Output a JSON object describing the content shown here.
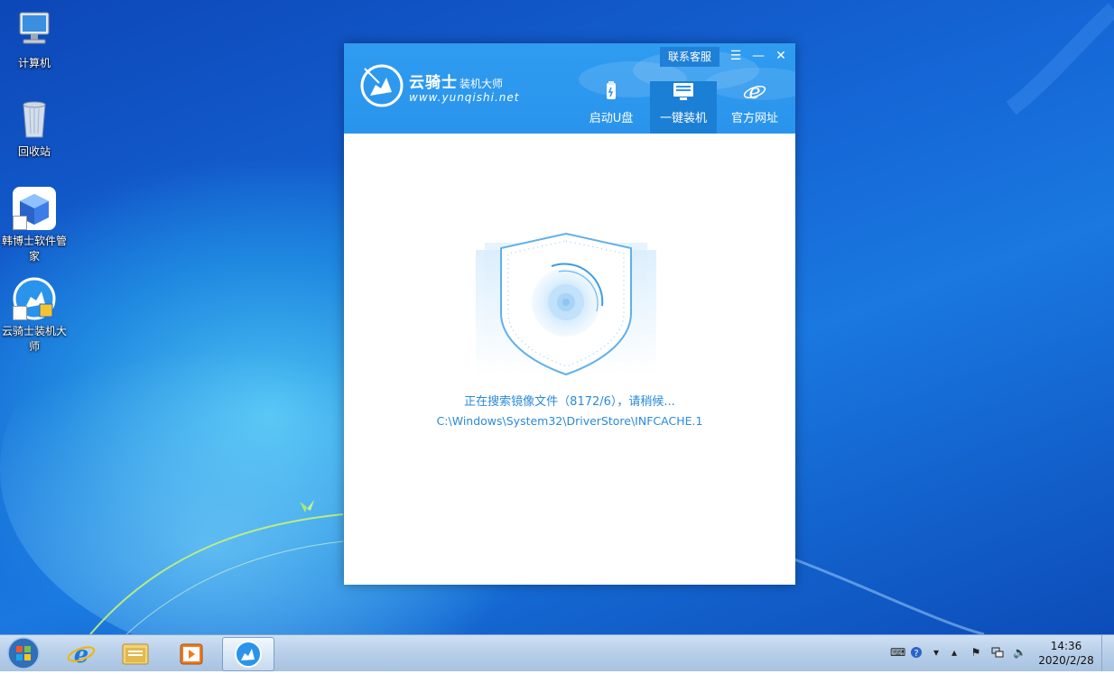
{
  "desktop": {
    "icons": [
      {
        "label": "计算机",
        "icon": "computer-icon"
      },
      {
        "label": "回收站",
        "icon": "recycle-bin-icon"
      },
      {
        "label": "韩博士软件管家",
        "icon": "hanboshi-app-icon"
      },
      {
        "label": "云骑士装机大师",
        "icon": "yunqishi-app-icon"
      }
    ]
  },
  "window": {
    "logo_name": "云骑士",
    "logo_suffix": "装机大师",
    "logo_url": "www.yunqishi.net",
    "service_button": "联系客服",
    "controls": {
      "menu": "☰",
      "minimize": "—",
      "close": "✕"
    },
    "nav": [
      {
        "label": "启动U盘",
        "icon": "usb-drive-icon",
        "active": false
      },
      {
        "label": "一键装机",
        "icon": "install-icon",
        "active": true
      },
      {
        "label": "官方网址",
        "icon": "ie-browser-icon",
        "active": false
      }
    ],
    "status_text": "正在搜索镜像文件（8172/6），请稍候...",
    "current_path": "C:\\Windows\\System32\\DriverStore\\INFCACHE.1",
    "accent_color": "#2a94ec"
  },
  "taskbar": {
    "pinned": [
      {
        "name": "internet-explorer",
        "icon": "ie-icon"
      },
      {
        "name": "file-explorer",
        "icon": "folder-icon"
      },
      {
        "name": "media-player",
        "icon": "media-player-icon"
      },
      {
        "name": "yunqishi",
        "icon": "yunqishi-app-icon",
        "active": true
      }
    ],
    "time": "14:36",
    "date": "2020/2/28"
  }
}
